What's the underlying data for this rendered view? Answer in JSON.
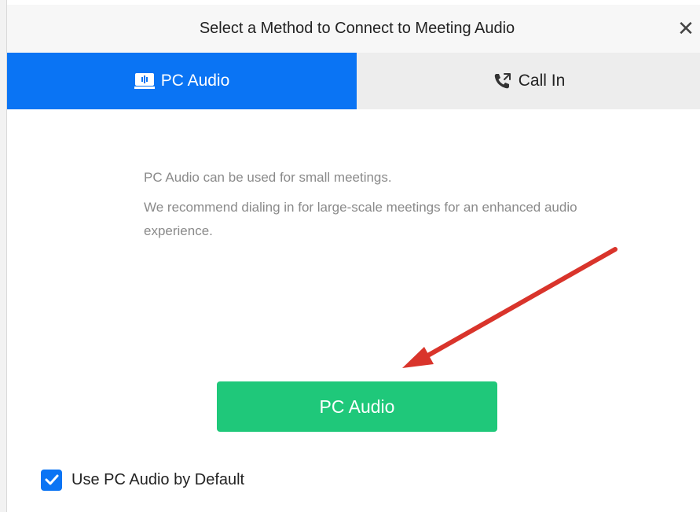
{
  "dialog": {
    "title": "Select a Method to Connect to Meeting Audio",
    "close_icon": "close-icon",
    "close_glyph": "✕"
  },
  "tabs": [
    {
      "label": "PC Audio",
      "icon": "computer-audio-icon",
      "selected": true
    },
    {
      "label": "Call In",
      "icon": "phone-call-icon",
      "selected": false
    }
  ],
  "body": {
    "line1": "PC Audio can be used for small meetings.",
    "line2": "We recommend dialing in for large-scale meetings for an enhanced audio experience."
  },
  "join_button": {
    "label": "PC Audio"
  },
  "default_option": {
    "label": "Use PC Audio by Default",
    "checked": true
  },
  "annotation": {
    "type": "arrow",
    "color": "#d9342b"
  },
  "colors": {
    "tab_active": "#0a74f4",
    "button": "#1fc87a",
    "checkbox": "#0a74f4",
    "arrow": "#d9342b"
  }
}
